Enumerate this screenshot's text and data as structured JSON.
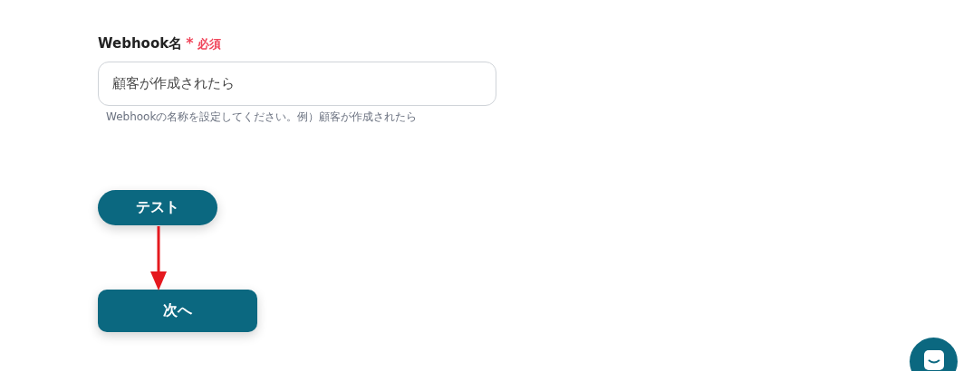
{
  "field": {
    "label": "Webhook名",
    "required_mark": "*",
    "required_text": "必須",
    "value": "顧客が作成されたら",
    "hint": "Webhookの名称を設定してください。例）顧客が作成されたら"
  },
  "test_button": {
    "label": "テスト"
  },
  "next_button": {
    "label": "次へ"
  }
}
